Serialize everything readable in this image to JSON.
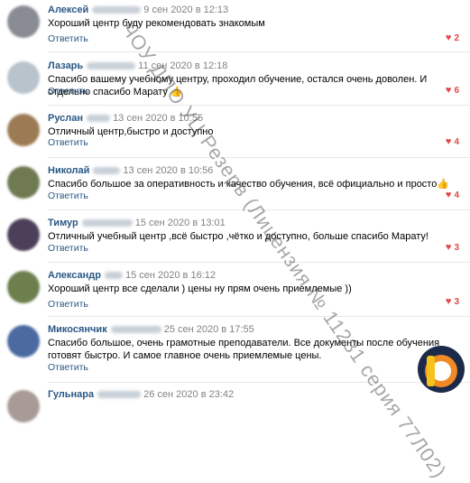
{
  "comments": [
    {
      "author": "Алексей",
      "date": "9 сен 2020 в 12:13",
      "text": "Хороший центр буду рекомендовать знакомым",
      "reply": "Ответить",
      "likes": "2",
      "avatar_color": "#8a8c95"
    },
    {
      "author": "Лазарь",
      "date": "11 сен 2020 в 12:18",
      "text": "Спасибо вашему учебному центру, проходил обучение, остался очень доволен. И отдельно спасибо Марату 👍",
      "reply": "Ответить",
      "likes": "6",
      "avatar_color": "#b9c3cc"
    },
    {
      "author": "Руслан",
      "date": "13 сен 2020 в 10:55",
      "text": "Отличный центр,быстро и доступно",
      "reply": "Ответить",
      "likes": "4",
      "avatar_color": "#9c7b54"
    },
    {
      "author": "Николай",
      "date": "13 сен 2020 в 10:56",
      "text": "Спасибо большое за оперативность и качество обучения, всё официально и просто👍",
      "reply": "Ответить",
      "likes": "4",
      "avatar_color": "#6f7a52"
    },
    {
      "author": "Тимур",
      "date": "15 сен 2020 в 13:01",
      "text": "Отличный учебный центр ,всё быстро ,чётко и доступно, больше спасибо Марату!",
      "reply": "Ответить",
      "likes": "3",
      "avatar_color": "#4c3f5a"
    },
    {
      "author": "Александр",
      "date": "15 сен 2020 в 16:12",
      "text": "Хороший центр все сделали ) цены ну прям очень приемлемые ))",
      "reply": "Ответить",
      "likes": "3",
      "avatar_color": "#6c7f4d"
    },
    {
      "author": "Микосянчик",
      "date": "25 сен 2020 в 17:55",
      "text": "Спасибо большое, очень грамотные преподаватели. Все документы после обучения готовят быстро. И самое главное очень приемлемые цены.",
      "reply": "Ответить",
      "likes": "",
      "avatar_color": "#4a6aa0"
    },
    {
      "author": "Гульнара",
      "date": "26 сен 2020 в 23:42",
      "text": "",
      "reply": "",
      "likes": "",
      "avatar_color": "#a89b96"
    }
  ],
  "watermark": "ЧОУ ДПО УЦ Резерв (Лицензия № 11231 серия 77Л02)",
  "colors": {
    "link": "#2a5885",
    "heart": "#e64646",
    "date": "#828282",
    "logo_yellow": "#f5c21b",
    "logo_orange": "#f08a24",
    "logo_dark": "#1c2a4a"
  }
}
